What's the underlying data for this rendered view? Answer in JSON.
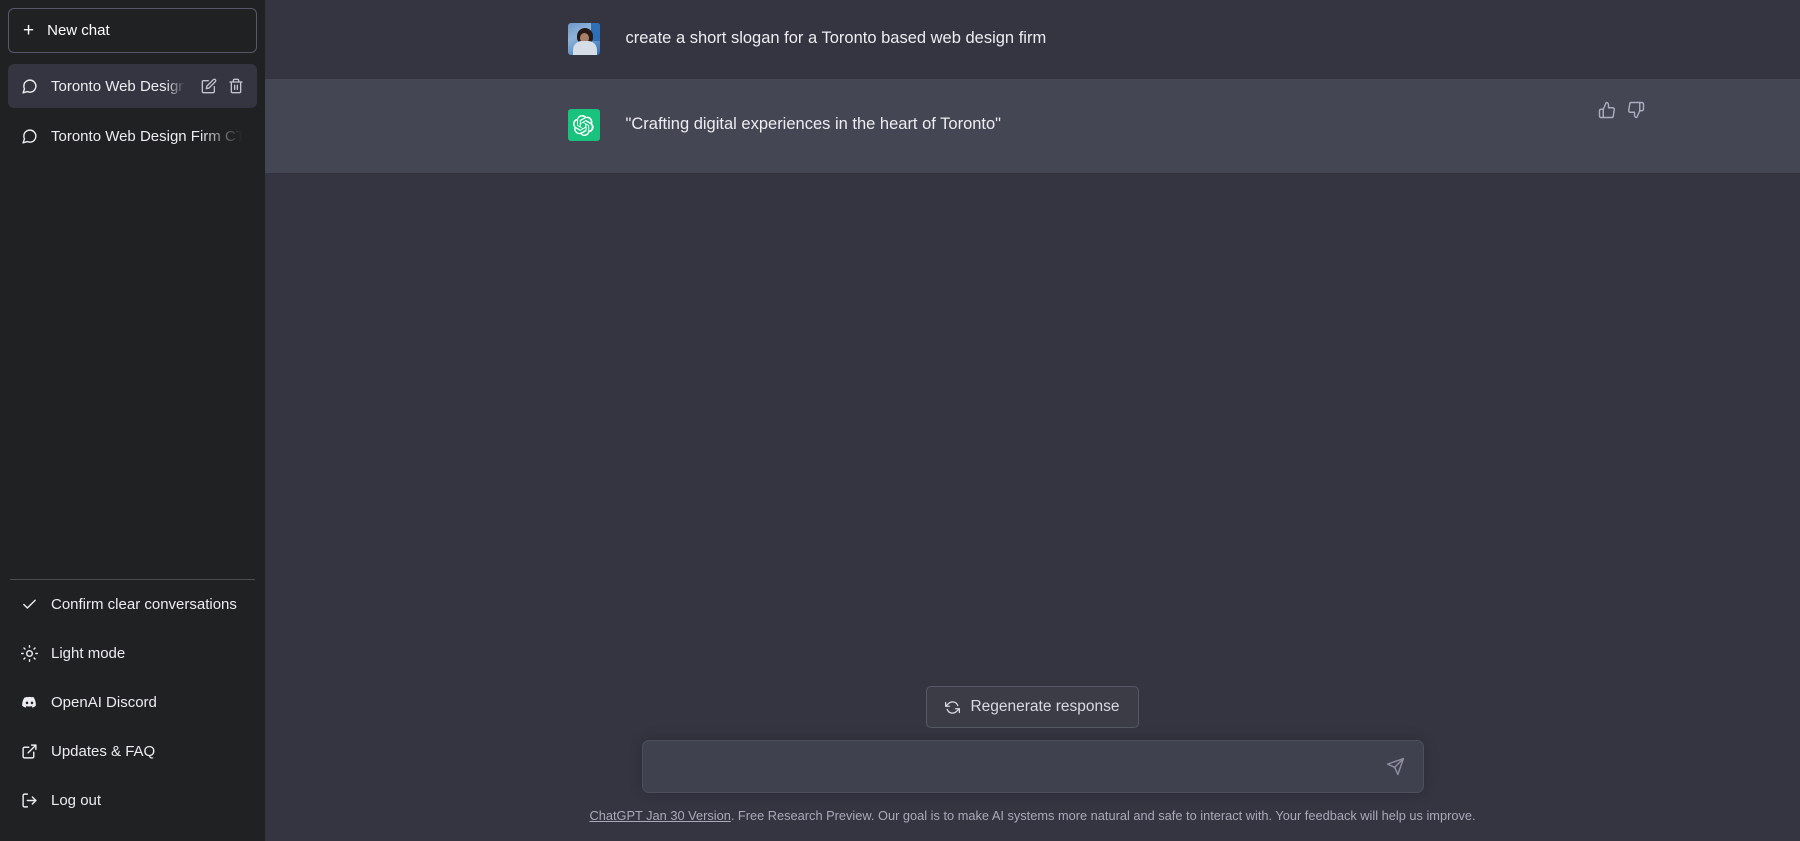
{
  "sidebar": {
    "new_chat_label": "New chat",
    "conversations": [
      {
        "title": "Toronto Web Design Sl",
        "active": true
      },
      {
        "title": "Toronto Web Design Firm CTA",
        "active": false
      }
    ],
    "menu": [
      {
        "label": "Confirm clear conversations",
        "icon": "check-icon"
      },
      {
        "label": "Light mode",
        "icon": "sun-icon"
      },
      {
        "label": "OpenAI Discord",
        "icon": "discord-icon"
      },
      {
        "label": "Updates & FAQ",
        "icon": "external-link-icon"
      },
      {
        "label": "Log out",
        "icon": "logout-icon"
      }
    ]
  },
  "conversation": {
    "messages": [
      {
        "role": "user",
        "text": "create a short slogan for a Toronto based web design firm"
      },
      {
        "role": "assistant",
        "text": "\"Crafting digital experiences in the heart of Toronto\""
      }
    ]
  },
  "composer": {
    "value": "",
    "placeholder": "",
    "regenerate_label": "Regenerate response",
    "send_icon": "send-icon"
  },
  "footer": {
    "link_text": "ChatGPT Jan 30 Version",
    "rest_text": ". Free Research Preview. Our goal is to make AI systems more natural and safe to interact with. Your feedback will help us improve."
  },
  "colors": {
    "sidebar_bg": "#202123",
    "main_bg": "#343541",
    "assistant_bg": "#444654",
    "accent_green": "#19c37d",
    "text_primary": "#ececf1",
    "text_muted": "#a9a9b8"
  }
}
